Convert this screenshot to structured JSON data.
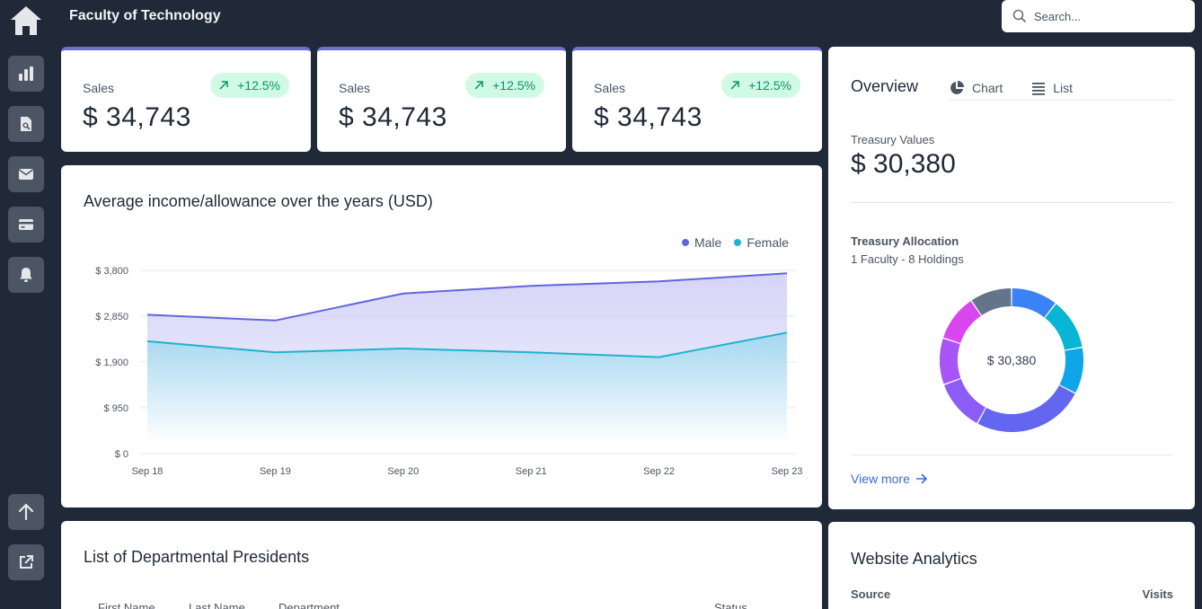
{
  "app": {
    "title": "Faculty of Technology"
  },
  "search": {
    "placeholder": "Search..."
  },
  "sidebar": {
    "items": [
      {
        "icon": "bar-chart-icon"
      },
      {
        "icon": "search-doc-icon"
      },
      {
        "icon": "mail-icon"
      },
      {
        "icon": "card-icon"
      },
      {
        "icon": "bell-icon"
      },
      {
        "icon": "arrow-up-icon"
      },
      {
        "icon": "external-link-icon"
      }
    ]
  },
  "stats": [
    {
      "label": "Sales",
      "value": "$ 34,743",
      "change": "+12.5%"
    },
    {
      "label": "Sales",
      "value": "$ 34,743",
      "change": "+12.5%"
    },
    {
      "label": "Sales",
      "value": "$ 34,743",
      "change": "+12.5%"
    }
  ],
  "income_chart": {
    "title": "Average income/allowance over the years (USD)",
    "legend": [
      "Male",
      "Female"
    ]
  },
  "chart_data": {
    "type": "area",
    "title": "Average income/allowance over the years (USD)",
    "categories": [
      "Sep 18",
      "Sep 19",
      "Sep 20",
      "Sep 21",
      "Sep 22",
      "Sep 23"
    ],
    "series": [
      {
        "name": "Male",
        "color": "#6366d9",
        "values": [
          2880,
          2760,
          3320,
          3480,
          3570,
          3740
        ]
      },
      {
        "name": "Female",
        "color": "#1fb3cc",
        "values": [
          2330,
          2100,
          2180,
          2100,
          2000,
          2510
        ]
      }
    ],
    "yticks": [
      "$ 3,800",
      "$ 2,850",
      "$ 1,900",
      "$ 950",
      "$ 0"
    ],
    "ytick_values": [
      3800,
      2850,
      1900,
      950,
      0
    ],
    "ylim": [
      0,
      3800
    ],
    "grid": true,
    "legend_position": "top-right"
  },
  "overview": {
    "title": "Overview",
    "tabs": [
      "Chart",
      "List"
    ],
    "treasury_label": "Treasury Values",
    "treasury_value": "$ 30,380",
    "allocation_title": "Treasury Allocation",
    "allocation_sub": "1 Faculty - 8 Holdings",
    "donut_center": "$ 30,380",
    "donut_segments": [
      {
        "color": "#3b82f6",
        "value": 10
      },
      {
        "color": "#06b6d4",
        "value": 11
      },
      {
        "color": "#0ea5e9",
        "value": 10
      },
      {
        "color": "#6366f1",
        "value": 24
      },
      {
        "color": "#8b5cf6",
        "value": 11
      },
      {
        "color": "#a855f7",
        "value": 10
      },
      {
        "color": "#d946ef",
        "value": 10
      },
      {
        "color": "#64748b",
        "value": 9
      }
    ],
    "view_more": "View more"
  },
  "presidents": {
    "title": "List of Departmental Presidents",
    "columns": [
      "First Name",
      "Last Name",
      "Department",
      "Status"
    ]
  },
  "analytics": {
    "title": "Website Analytics",
    "columns": [
      "Source",
      "Visits"
    ]
  }
}
